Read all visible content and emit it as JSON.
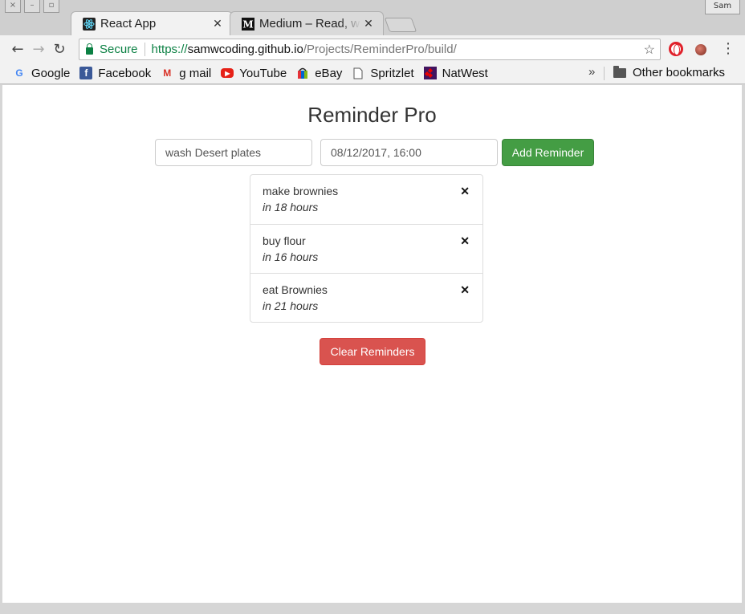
{
  "window": {
    "profile_label": "Sam"
  },
  "tabs": [
    {
      "title": "React App",
      "icon": "react-icon",
      "active": true
    },
    {
      "title": "Medium – Read, write",
      "icon": "medium-icon",
      "active": false
    }
  ],
  "toolbar": {
    "secure_label": "Secure",
    "url_scheme": "https://",
    "url_host": "samwcoding.github.io",
    "url_path": "/Projects/ReminderPro/build/"
  },
  "bookmarks": [
    {
      "label": "Google",
      "icon": "google-icon"
    },
    {
      "label": "Facebook",
      "icon": "facebook-icon"
    },
    {
      "label": "g mail",
      "icon": "gmail-icon"
    },
    {
      "label": "YouTube",
      "icon": "youtube-icon"
    },
    {
      "label": "eBay",
      "icon": "ebay-icon"
    },
    {
      "label": "Spritzlet",
      "icon": "page-icon"
    },
    {
      "label": "NatWest",
      "icon": "natwest-icon"
    }
  ],
  "bookmarks_more": "»",
  "other_bookmarks": "Other bookmarks",
  "app": {
    "title": "Reminder Pro",
    "reminder_input_value": "wash Desert plates",
    "date_input_value": "08/12/2017, 16:00",
    "add_button": "Add Reminder",
    "clear_button": "Clear Reminders",
    "reminders": [
      {
        "text": "make brownies",
        "due": "in 18 hours"
      },
      {
        "text": "buy flour",
        "due": "in 16 hours"
      },
      {
        "text": "eat Brownies",
        "due": "in 21 hours"
      }
    ],
    "colors": {
      "add_button": "#449d44",
      "clear_button": "#d9534f"
    }
  }
}
